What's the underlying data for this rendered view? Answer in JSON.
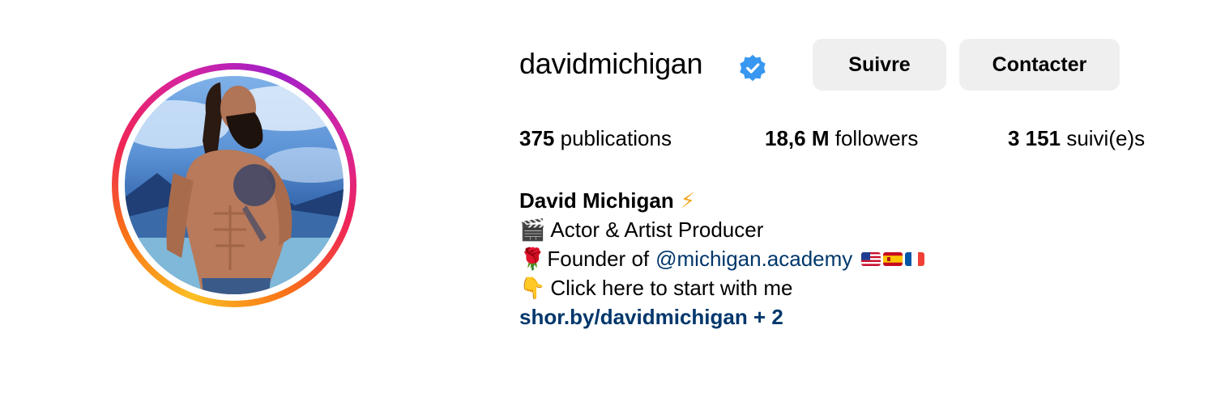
{
  "profile": {
    "username": "davidmichigan",
    "verified": true,
    "follow_label": "Suivre",
    "contact_label": "Contacter",
    "stats": {
      "posts_count": "375",
      "posts_label": "publications",
      "followers_count": "18,6 M",
      "followers_label": "followers",
      "following_count": "3 151",
      "following_label": "suivi(e)s"
    },
    "bio": {
      "name": "David Michigan",
      "name_emoji": "⚡",
      "line1_emoji": "🎬",
      "line1_text": "Actor & Artist Producer",
      "line2_emoji": "🌹",
      "line2_text": "Founder of",
      "line2_mention": "@michigan.academy",
      "flags": [
        "us-flag",
        "spain-flag",
        "france-flag"
      ],
      "line3_emoji": "👇",
      "line3_text": "Click here to start with me",
      "link_text": "shor.by/davidmichigan + 2"
    }
  },
  "colors": {
    "verified_blue": "#3897f0",
    "link_blue": "#00376b",
    "button_bg": "#efefef"
  },
  "icons": {
    "verified": "verified-badge-icon",
    "avatar": "profile-avatar"
  }
}
